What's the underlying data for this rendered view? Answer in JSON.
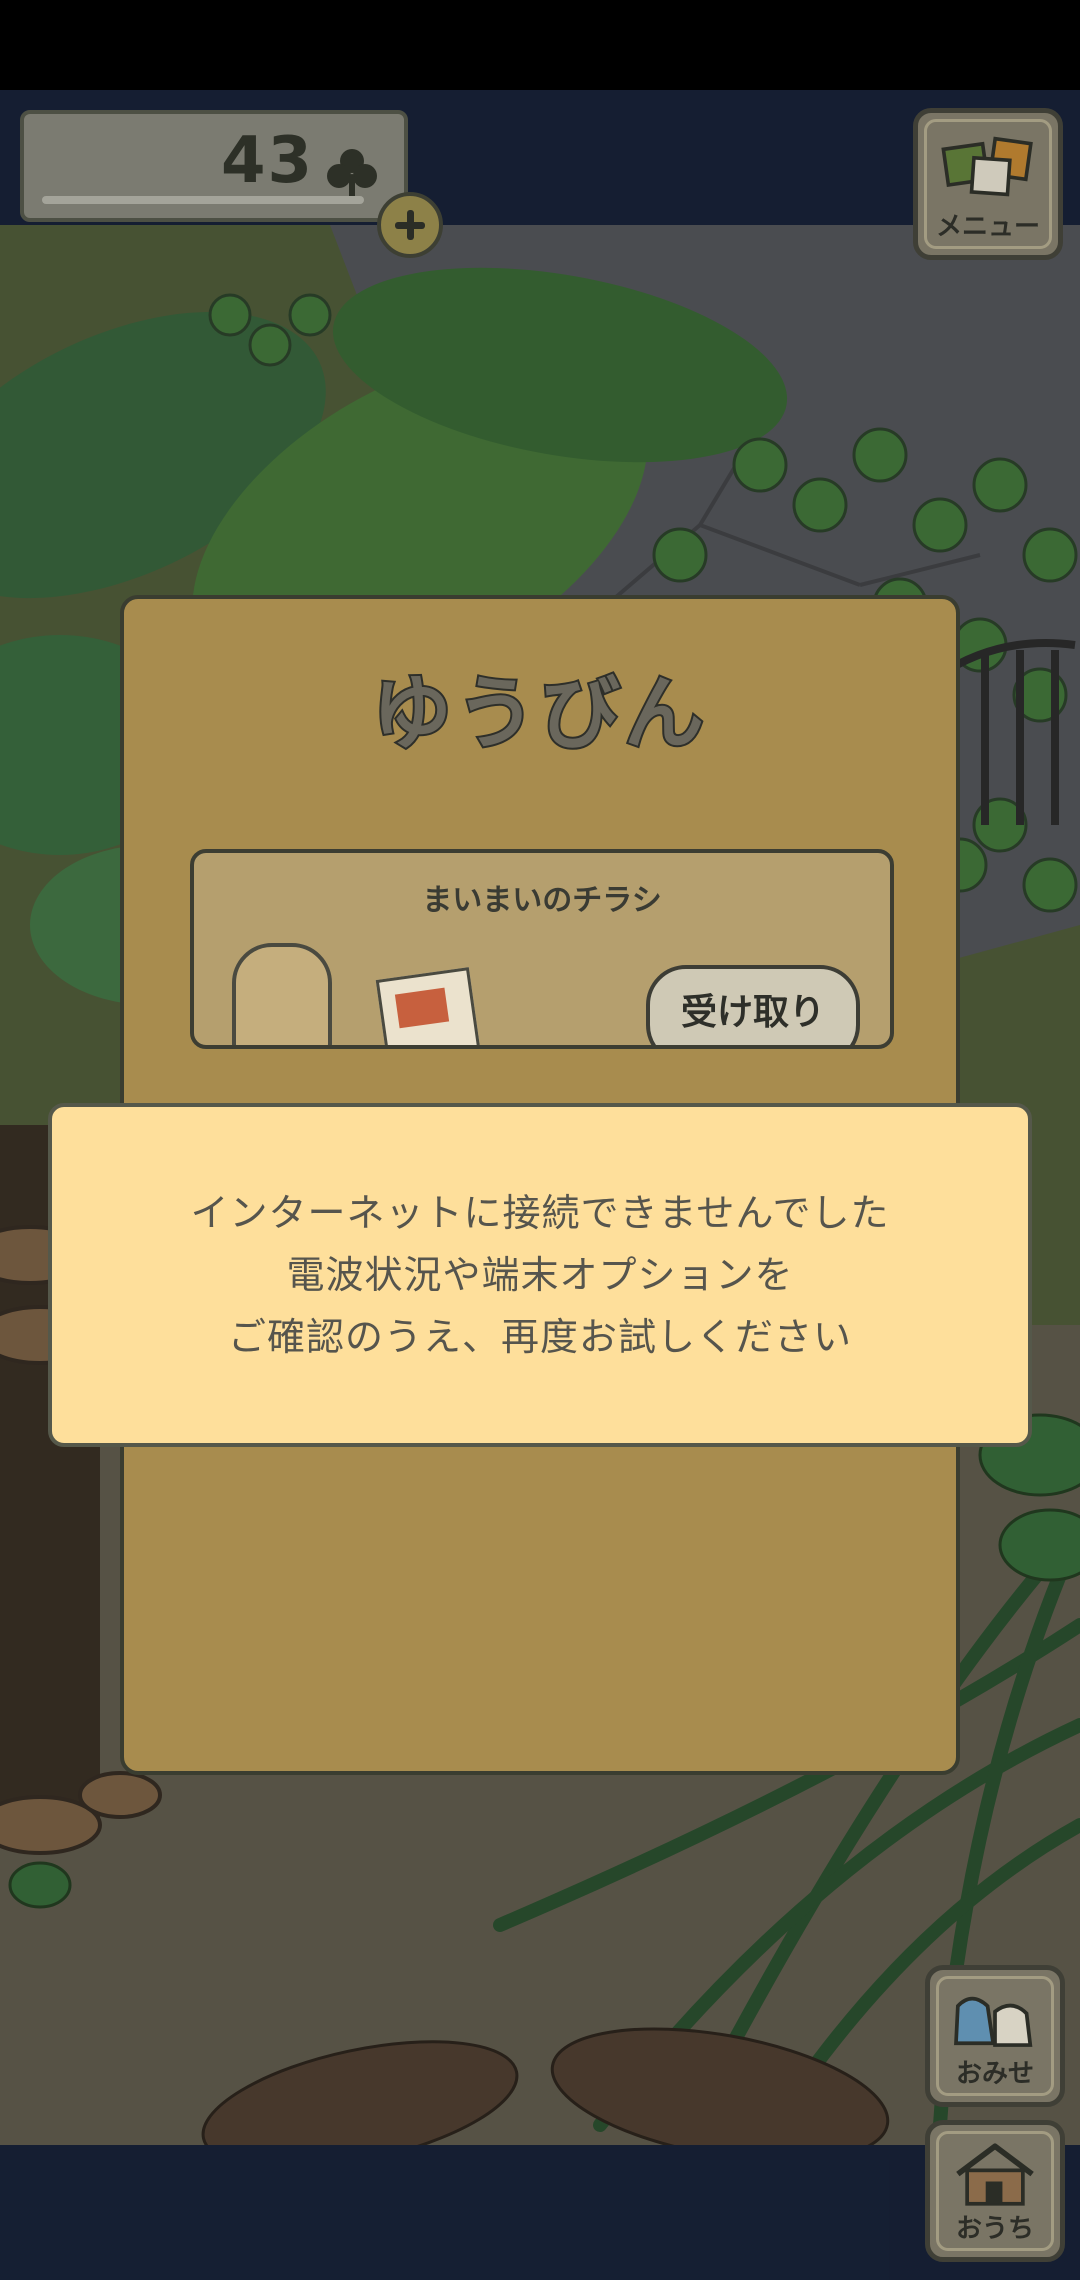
{
  "clover_counter": {
    "count": "43"
  },
  "menu_button": {
    "label": "メニュー"
  },
  "mail_panel": {
    "title": "ゆうびん",
    "items": [
      {
        "title": "まいまいのチラシ",
        "receive_label": "受け取り"
      }
    ]
  },
  "error_dialog": {
    "lines": [
      "インターネットに接続できませんでした",
      "電波状況や端末オプションを",
      "ご確認のうえ、再度お試しください"
    ]
  },
  "shop_button": {
    "label": "おみせ"
  },
  "home_button": {
    "label": "おうち"
  },
  "colors": {
    "dialog_bg": "#fedf9b",
    "panel_bg": "#a88c4e",
    "frame": "#16223b"
  }
}
